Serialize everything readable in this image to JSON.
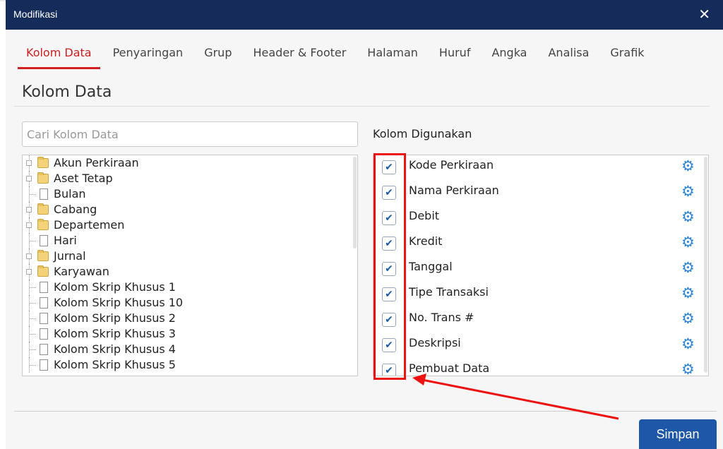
{
  "window": {
    "title": "Modifikasi",
    "close_label": "✕"
  },
  "tabs": [
    {
      "label": "Kolom Data",
      "active": true
    },
    {
      "label": "Penyaringan"
    },
    {
      "label": "Grup"
    },
    {
      "label": "Header & Footer"
    },
    {
      "label": "Halaman"
    },
    {
      "label": "Huruf"
    },
    {
      "label": "Angka"
    },
    {
      "label": "Analisa"
    },
    {
      "label": "Grafik"
    }
  ],
  "section": {
    "title": "Kolom Data"
  },
  "search": {
    "placeholder": "Cari Kolom Data"
  },
  "available_columns": [
    {
      "label": "Akun Perkiraan",
      "icon": "folder-icon"
    },
    {
      "label": "Aset Tetap",
      "icon": "folder-icon"
    },
    {
      "label": "Bulan",
      "icon": "file-icon"
    },
    {
      "label": "Cabang",
      "icon": "folder-icon"
    },
    {
      "label": "Departemen",
      "icon": "folder-icon"
    },
    {
      "label": "Hari",
      "icon": "file-icon"
    },
    {
      "label": "Jurnal",
      "icon": "folder-icon"
    },
    {
      "label": "Karyawan",
      "icon": "folder-icon"
    },
    {
      "label": "Kolom Skrip Khusus 1",
      "icon": "file-icon"
    },
    {
      "label": "Kolom Skrip Khusus 10",
      "icon": "file-icon"
    },
    {
      "label": "Kolom Skrip Khusus 2",
      "icon": "file-icon"
    },
    {
      "label": "Kolom Skrip Khusus 3",
      "icon": "file-icon"
    },
    {
      "label": "Kolom Skrip Khusus 4",
      "icon": "file-icon"
    },
    {
      "label": "Kolom Skrip Khusus 5",
      "icon": "file-icon"
    }
  ],
  "used_columns": {
    "label": "Kolom Digunakan",
    "items": [
      {
        "label": "Kode Perkiraan",
        "checked": true
      },
      {
        "label": "Nama Perkiraan",
        "checked": true
      },
      {
        "label": "Debit",
        "checked": true
      },
      {
        "label": "Kredit",
        "checked": true
      },
      {
        "label": "Tanggal",
        "checked": true
      },
      {
        "label": "Tipe Transaksi",
        "checked": true
      },
      {
        "label": "No. Trans #",
        "checked": true
      },
      {
        "label": "Deskripsi",
        "checked": true
      },
      {
        "label": "Pembuat Data",
        "checked": true
      }
    ]
  },
  "footer": {
    "save_label": "Simpan"
  },
  "colors": {
    "titlebar": "#152b5a",
    "accent_red": "#d02020",
    "save_button": "#1e56a8",
    "gear": "#2f86d6"
  }
}
